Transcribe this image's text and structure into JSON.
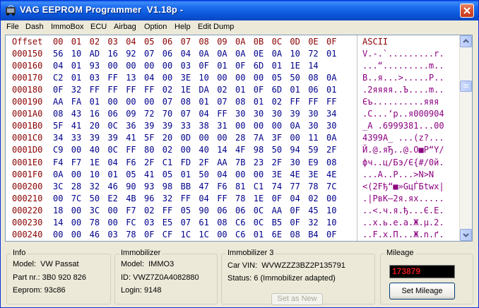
{
  "window": {
    "title": "VAG EEPROM Programmer  V1.18p -",
    "icon": "car-chip-icon",
    "close_icon": "close-icon"
  },
  "menu": [
    "File",
    "Dash",
    "ImmoBox",
    "ECU",
    "Airbag",
    "Option",
    "Help",
    "Edit Dump"
  ],
  "hex": {
    "header": {
      "offset": "Offset",
      "cols": [
        "00",
        "01",
        "02",
        "03",
        "04",
        "05",
        "06",
        "07",
        "08",
        "09",
        "0A",
        "0B",
        "0C",
        "0D",
        "0E",
        "0F"
      ],
      "ascii": "ASCII"
    },
    "rows": [
      {
        "offset": "000150",
        "bytes": [
          "56",
          "10",
          "AD",
          "16",
          "92",
          "07",
          "06",
          "04",
          "0A",
          "0A",
          "0A",
          "0E",
          "0A",
          "10",
          "72",
          "01"
        ],
        "ascii": "V.-.`.........r."
      },
      {
        "offset": "000160",
        "bytes": [
          "04",
          "01",
          "93",
          "00",
          "00",
          "00",
          "00",
          "03",
          "0F",
          "01",
          "0F",
          "6D",
          "01",
          "1E",
          "14"
        ],
        "ascii": "...“.........m.."
      },
      {
        "offset": "000170",
        "bytes": [
          "C2",
          "01",
          "03",
          "FF",
          "13",
          "04",
          "00",
          "3E",
          "10",
          "00",
          "00",
          "00",
          "05",
          "50",
          "08",
          "0A"
        ],
        "ascii": "В..я...>.....P.."
      },
      {
        "offset": "000180",
        "bytes": [
          "0F",
          "32",
          "FF",
          "FF",
          "FF",
          "FF",
          "02",
          "1E",
          "DA",
          "02",
          "01",
          "0F",
          "6D",
          "01",
          "06",
          "01"
        ],
        "ascii": ".2яяяя..Ъ....m.."
      },
      {
        "offset": "000190",
        "bytes": [
          "AA",
          "FA",
          "01",
          "00",
          "00",
          "00",
          "07",
          "08",
          "01",
          "07",
          "08",
          "01",
          "02",
          "FF",
          "FF",
          "FF"
        ],
        "ascii": "Єъ..........яяя"
      },
      {
        "offset": "0001A0",
        "bytes": [
          "08",
          "43",
          "16",
          "06",
          "09",
          "72",
          "70",
          "07",
          "04",
          "FF",
          "30",
          "30",
          "30",
          "39",
          "30",
          "34"
        ],
        "ascii": ".C...‘p..я000904"
      },
      {
        "offset": "0001B0",
        "bytes": [
          "5F",
          "41",
          "20",
          "0C",
          "36",
          "39",
          "39",
          "33",
          "38",
          "31",
          "00",
          "00",
          "00",
          "0A",
          "30",
          "30"
        ],
        "ascii": "_A .6999381...00"
      },
      {
        "offset": "0001C0",
        "bytes": [
          "34",
          "33",
          "39",
          "39",
          "41",
          "5F",
          "20",
          "0D",
          "00",
          "00",
          "28",
          "7A",
          "3F",
          "00",
          "11",
          "0A"
        ],
        "ascii": "4399A_ ...(z?..."
      },
      {
        "offset": "0001D0",
        "bytes": [
          "C9",
          "00",
          "40",
          "0C",
          "FF",
          "80",
          "02",
          "00",
          "40",
          "14",
          "4F",
          "98",
          "50",
          "94",
          "59",
          "2F"
        ],
        "ascii": "Й.@.яЂ..@.O■P“Y/"
      },
      {
        "offset": "0001E0",
        "bytes": [
          "F4",
          "F7",
          "1E",
          "04",
          "F6",
          "2F",
          "C1",
          "FD",
          "2F",
          "AA",
          "7B",
          "23",
          "2F",
          "30",
          "E9",
          "08"
        ],
        "ascii": "фч..ц/Бэ/Є{#/0й."
      },
      {
        "offset": "0001F0",
        "bytes": [
          "0A",
          "00",
          "10",
          "01",
          "05",
          "41",
          "05",
          "01",
          "50",
          "04",
          "00",
          "00",
          "3E",
          "4E",
          "3E",
          "4E"
        ],
        "ascii": "...A..P...>N>N"
      },
      {
        "offset": "000200",
        "bytes": [
          "3C",
          "28",
          "32",
          "46",
          "90",
          "93",
          "98",
          "BB",
          "47",
          "F6",
          "81",
          "C1",
          "74",
          "77",
          "78",
          "7C"
        ],
        "ascii": "<(2Fђ“■»GцЃБtwx|"
      },
      {
        "offset": "000210",
        "bytes": [
          "00",
          "7C",
          "50",
          "E2",
          "4B",
          "96",
          "32",
          "FF",
          "04",
          "FF",
          "78",
          "1E",
          "0F",
          "04",
          "02",
          "00"
        ],
        "ascii": ".|PвK–2я.яx....."
      },
      {
        "offset": "000220",
        "bytes": [
          "18",
          "00",
          "3C",
          "00",
          "F7",
          "02",
          "FF",
          "05",
          "90",
          "06",
          "06",
          "0C",
          "AA",
          "0F",
          "45",
          "10"
        ],
        "ascii": "..<.ч.я.ђ...Є.E."
      },
      {
        "offset": "000230",
        "bytes": [
          "14",
          "00",
          "78",
          "00",
          "FC",
          "03",
          "E5",
          "07",
          "61",
          "08",
          "C6",
          "0C",
          "B5",
          "0F",
          "32",
          "10"
        ],
        "ascii": "..x.ь.е.a.Ж.µ.2."
      },
      {
        "offset": "000240",
        "bytes": [
          "00",
          "00",
          "46",
          "03",
          "78",
          "0F",
          "CF",
          "1C",
          "1C",
          "00",
          "C6",
          "01",
          "6E",
          "08",
          "B4",
          "0F"
        ],
        "ascii": "..F.x.П...Ж.n.ґ."
      }
    ]
  },
  "info": {
    "title": "Info",
    "model": "Model:  VW Passat",
    "part": "Part nr.: 3B0 920 826",
    "eeprom": "Eeprom: 93c86"
  },
  "immobilizer": {
    "title": "Immobilizer",
    "model": "Model:  IMMO3",
    "id": "ID: VWZ7Z0A4082880",
    "login": "Login: 9148"
  },
  "immobilizer3": {
    "title": "Immobilizer 3",
    "vin": "Car VIN:  WVWZZZ3BZ2P135791",
    "status": "Status: 6 (Immobilizer adapted)",
    "set_new_label": "Set as New"
  },
  "mileage": {
    "title": "Mileage",
    "value": "173879",
    "set_label": "Set Mileage"
  },
  "colors": {
    "title_bar": "#0A56D8",
    "hex_offset": "#8B0000",
    "hex_bytes": "#00008B",
    "hex_ascii": "#8B0080",
    "mileage_digits": "#E01818"
  }
}
